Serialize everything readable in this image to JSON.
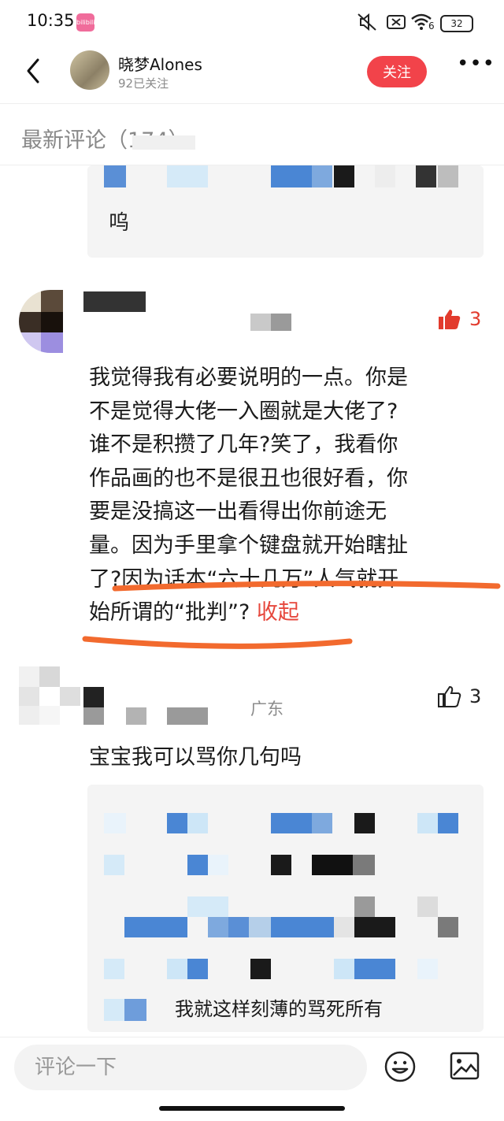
{
  "status_bar": {
    "time": "10:35",
    "app_badge": "bilibili",
    "signal_suffix": "6",
    "battery": "32"
  },
  "header": {
    "author_name": "晓梦Alones",
    "follow_count": "92已关注",
    "follow_button": "关注",
    "more_label": "•••"
  },
  "section": {
    "title": "最新评论（174）"
  },
  "reply_preview": {
    "text": "呜"
  },
  "comment_1": {
    "likes": "3",
    "lines": [
      "我觉得我有必要说明的一点。你是",
      "不是觉得大佬一入圈就是大佬了?",
      "谁不是积攒了几年?笑了，我看你",
      "作品画的也不是很丑也很好看，你",
      "要是没搞这一出看得出你前途无",
      "量。因为手里拿个键盘就开始瞎扯",
      "了?因为话本“六十几万”人气就开"
    ],
    "last_line": "始所谓的“批判”? ",
    "collapse": "收起"
  },
  "comment_2": {
    "region": "广东",
    "likes": "3",
    "text": "宝宝我可以骂你几句吗",
    "reply_snippet": "我就这样刻薄的骂死所有"
  },
  "bottom": {
    "input_placeholder": "评论一下"
  },
  "colors": {
    "accent_red": "#f2434a",
    "annotation_orange": "#f26a2e",
    "collapse_red": "#e6473c"
  },
  "icons": [
    "back-arrow-icon",
    "more-icon",
    "thumbs-up-icon",
    "emoji-icon",
    "image-icon",
    "mute-icon",
    "sim-icon",
    "wifi-icon"
  ]
}
